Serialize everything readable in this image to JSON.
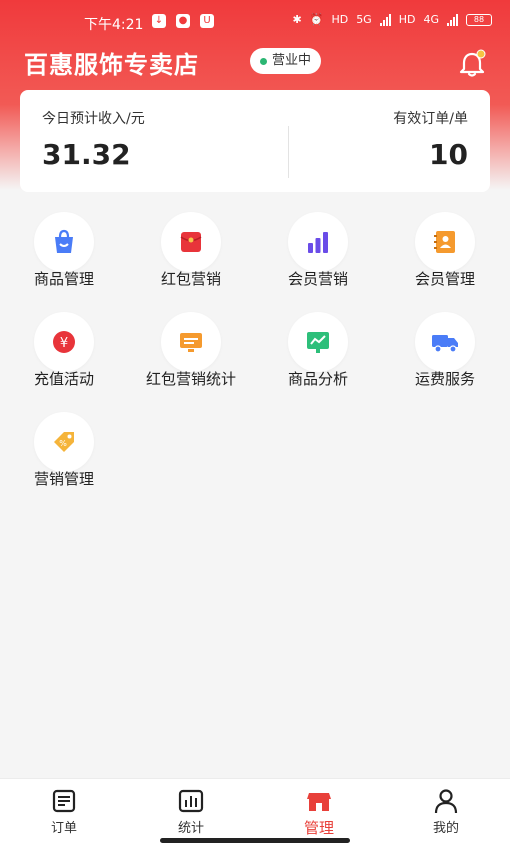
{
  "status_bar": {
    "time": "下午4:21",
    "network_1": "5G",
    "network_2": "4G",
    "hd_1": "HD",
    "hd_2": "HD",
    "battery": "88"
  },
  "header": {
    "store_name": "百惠服饰专卖店",
    "status_badge": "营业中",
    "accent": "#f03a3c"
  },
  "summary": {
    "income_label": "今日预计收入/元",
    "income_value": "31.32",
    "orders_label": "有效订单/单",
    "orders_value": "10"
  },
  "menu": {
    "items": [
      {
        "label": "商品管理",
        "icon": "shopping-bag-icon"
      },
      {
        "label": "红包营销",
        "icon": "red-envelope-icon"
      },
      {
        "label": "会员营销",
        "icon": "bar-chart-icon"
      },
      {
        "label": "会员管理",
        "icon": "member-card-icon"
      },
      {
        "label": "充值活动",
        "icon": "yuan-coin-icon"
      },
      {
        "label": "红包营销统计",
        "icon": "monitor-stats-icon"
      },
      {
        "label": "商品分析",
        "icon": "trend-board-icon"
      },
      {
        "label": "运费服务",
        "icon": "truck-icon"
      },
      {
        "label": "营销管理",
        "icon": "price-tag-icon"
      }
    ]
  },
  "bottom_nav": {
    "items": [
      {
        "label": "订单",
        "icon": "order-list-icon"
      },
      {
        "label": "统计",
        "icon": "statistics-icon"
      },
      {
        "label": "管理",
        "icon": "shop-icon",
        "active": true
      },
      {
        "label": "我的",
        "icon": "user-icon"
      }
    ]
  }
}
